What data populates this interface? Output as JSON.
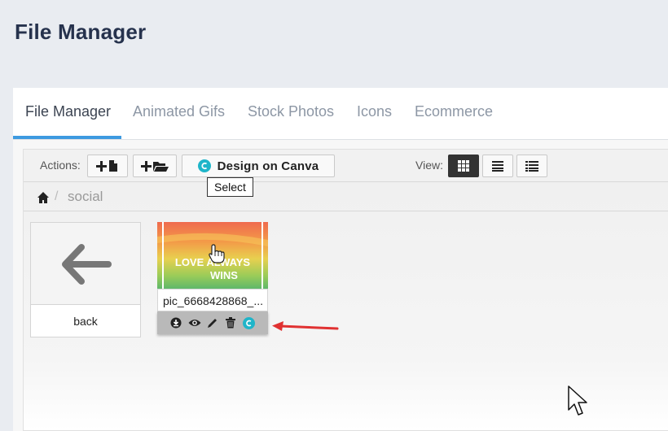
{
  "page": {
    "title": "File Manager"
  },
  "tabs": [
    {
      "label": "File Manager",
      "active": true
    },
    {
      "label": "Animated Gifs",
      "active": false
    },
    {
      "label": "Stock Photos",
      "active": false
    },
    {
      "label": "Icons",
      "active": false
    },
    {
      "label": "Ecommerce",
      "active": false
    }
  ],
  "toolbar": {
    "actions_label": "Actions:",
    "new_file_icon": "plus-file-icon",
    "new_folder_icon": "plus-folder-icon",
    "canva_label": "Design on Canva",
    "view_label": "View:",
    "view_modes": [
      "grid-view-icon",
      "list-view-icon",
      "detail-view-icon"
    ],
    "active_view": "grid"
  },
  "breadcrumb": {
    "current": "social"
  },
  "items": {
    "back": {
      "label": "back"
    },
    "file": {
      "name": "pic_6668428868_...",
      "thumb_text_1": "LOVE ALWAYS",
      "thumb_text_2": "WINS",
      "actions": [
        "download-icon",
        "preview-eye-icon",
        "edit-pencil-icon",
        "delete-trash-icon",
        "canva-icon"
      ]
    }
  },
  "tooltip": {
    "text": "Select"
  },
  "colors": {
    "accent": "#3d9ae0",
    "canva": "#1fb5c9",
    "annotation_arrow": "#e03131",
    "title": "#26324d"
  }
}
